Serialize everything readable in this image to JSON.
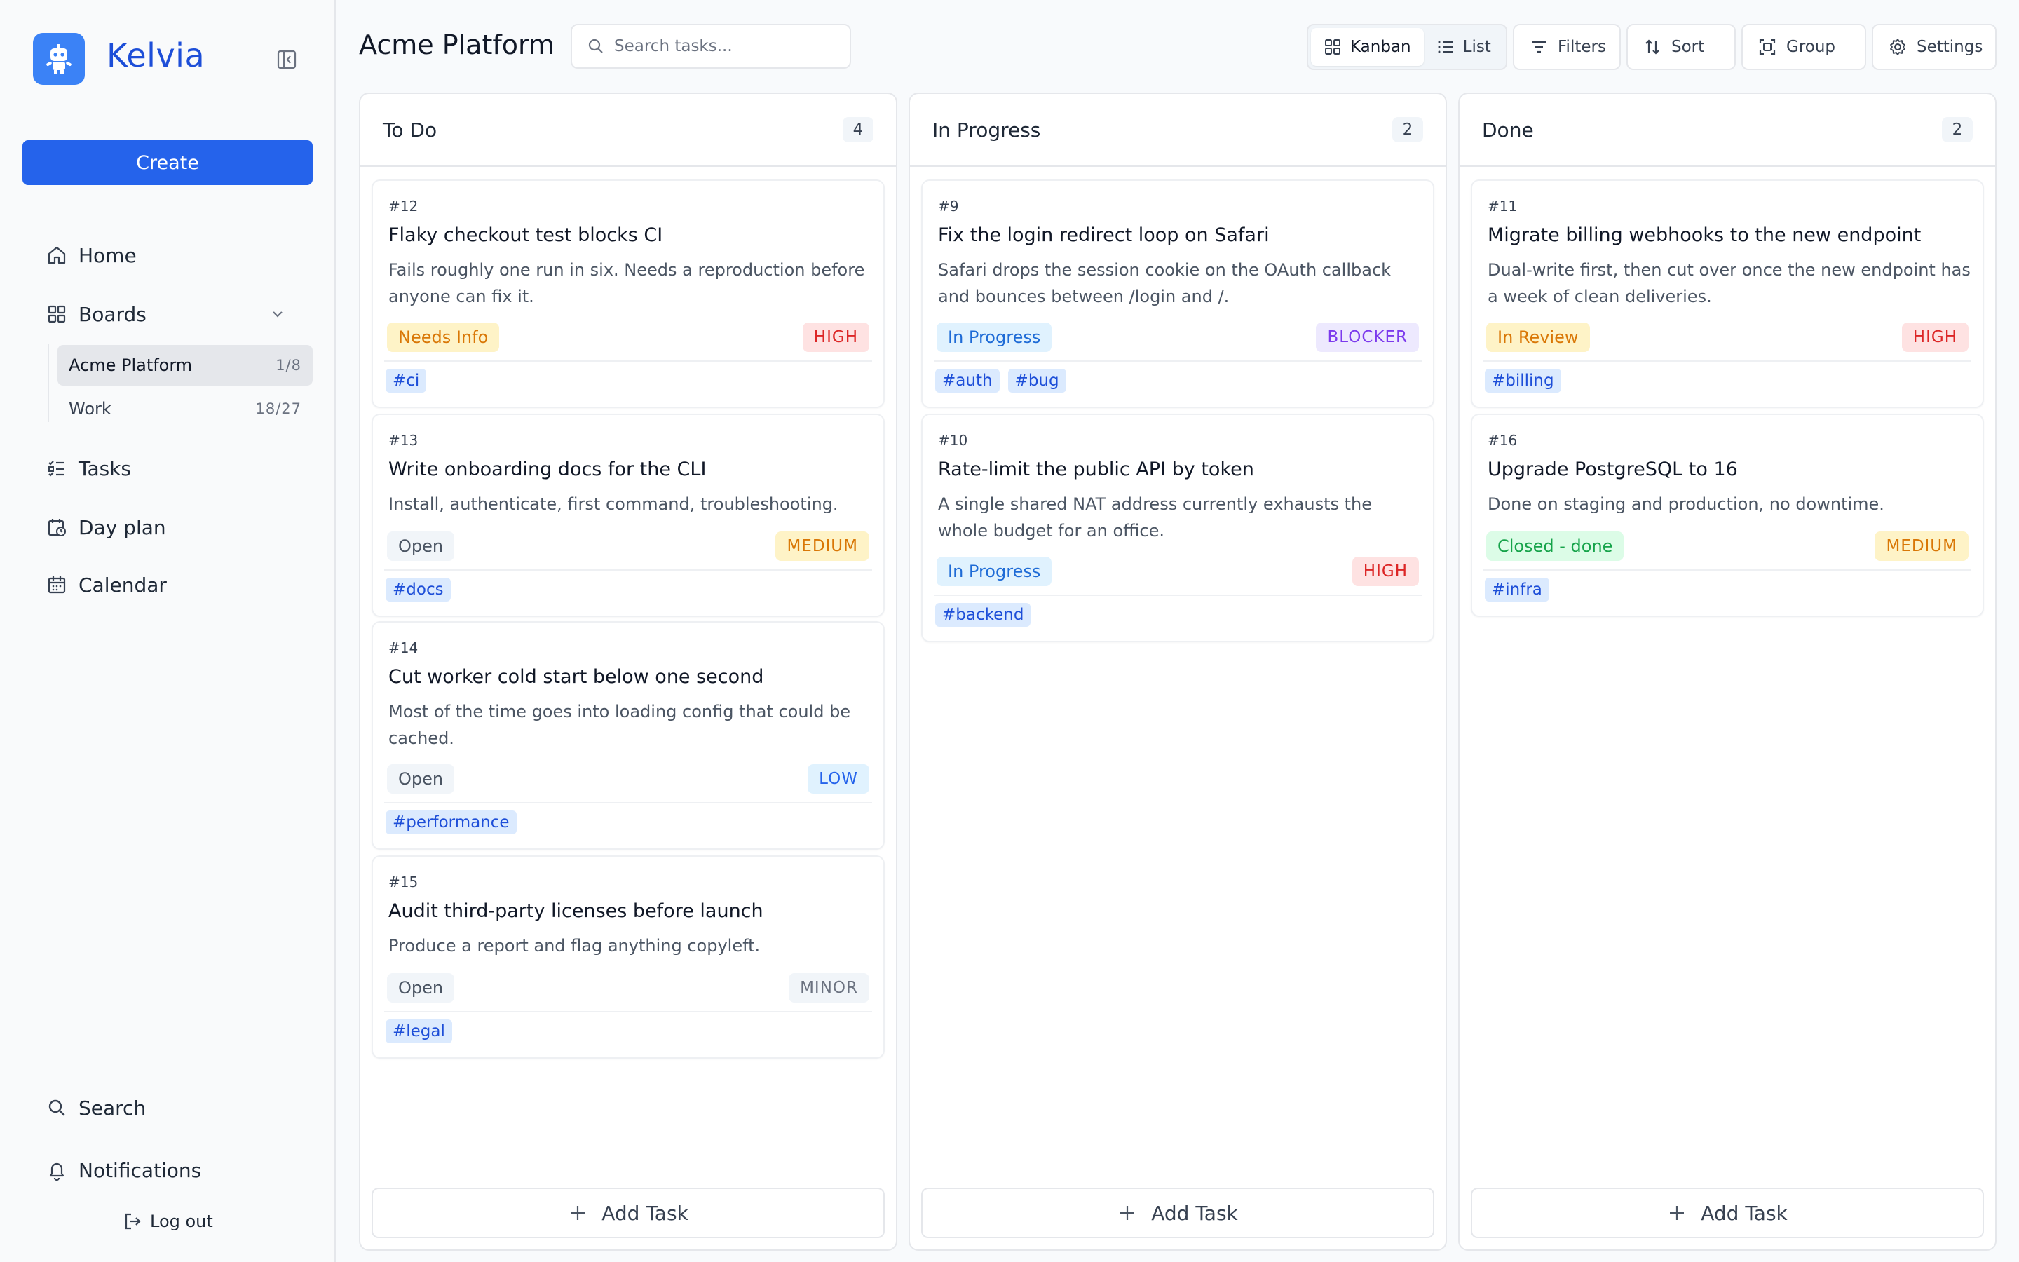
{
  "app": {
    "name": "Kelvia"
  },
  "sidebar": {
    "create_label": "Create",
    "nav": {
      "home": "Home",
      "boards": "Boards",
      "tasks": "Tasks",
      "day_plan": "Day plan",
      "calendar": "Calendar"
    },
    "boards": [
      {
        "label": "Acme Platform",
        "count": "1/8"
      },
      {
        "label": "Work",
        "count": "18/27"
      }
    ],
    "search": "Search",
    "notifications": "Notifications",
    "logout": "Log out"
  },
  "header": {
    "title": "Acme Platform",
    "search_placeholder": "Search tasks...",
    "views": {
      "kanban": "Kanban",
      "list": "List"
    },
    "filters": "Filters",
    "sort": "Sort",
    "group": "Group",
    "settings": "Settings"
  },
  "columns": [
    {
      "title": "To Do",
      "count": "4",
      "cards": [
        {
          "num": "#12",
          "title": "Flaky checkout test blocks CI",
          "desc": "Fails roughly one run in six. Needs a reproduction before anyone can fix it.",
          "status": "Needs Info",
          "priority": "HIGH",
          "tags": [
            "#ci"
          ]
        },
        {
          "num": "#13",
          "title": "Write onboarding docs for the CLI",
          "desc": "Install, authenticate, first command, troubleshooting.",
          "status": "Open",
          "priority": "MEDIUM",
          "tags": [
            "#docs"
          ]
        },
        {
          "num": "#14",
          "title": "Cut worker cold start below one second",
          "desc": "Most of the time goes into loading config that could be cached.",
          "status": "Open",
          "priority": "LOW",
          "tags": [
            "#performance"
          ]
        },
        {
          "num": "#15",
          "title": "Audit third-party licenses before launch",
          "desc": "Produce a report and flag anything copyleft.",
          "status": "Open",
          "priority": "MINOR",
          "tags": [
            "#legal"
          ]
        }
      ],
      "add_label": "Add Task"
    },
    {
      "title": "In Progress",
      "count": "2",
      "cards": [
        {
          "num": "#9",
          "title": "Fix the login redirect loop on Safari",
          "desc": "Safari drops the session cookie on the OAuth callback and bounces between /login and /.",
          "status": "In Progress",
          "priority": "BLOCKER",
          "tags": [
            "#auth",
            "#bug"
          ]
        },
        {
          "num": "#10",
          "title": "Rate-limit the public API by token",
          "desc": "A single shared NAT address currently exhausts the whole budget for an office.",
          "status": "In Progress",
          "priority": "HIGH",
          "tags": [
            "#backend"
          ]
        }
      ],
      "add_label": "Add Task"
    },
    {
      "title": "Done",
      "count": "2",
      "cards": [
        {
          "num": "#11",
          "title": "Migrate billing webhooks to the new endpoint",
          "desc": "Dual-write first, then cut over once the new endpoint has a week of clean deliveries.",
          "status": "In Review",
          "priority": "HIGH",
          "tags": [
            "#billing"
          ]
        },
        {
          "num": "#16",
          "title": "Upgrade PostgreSQL to 16",
          "desc": "Done on staging and production, no downtime.",
          "status": "Closed - done",
          "priority": "MEDIUM",
          "tags": [
            "#infra"
          ]
        }
      ],
      "add_label": "Add Task"
    }
  ]
}
